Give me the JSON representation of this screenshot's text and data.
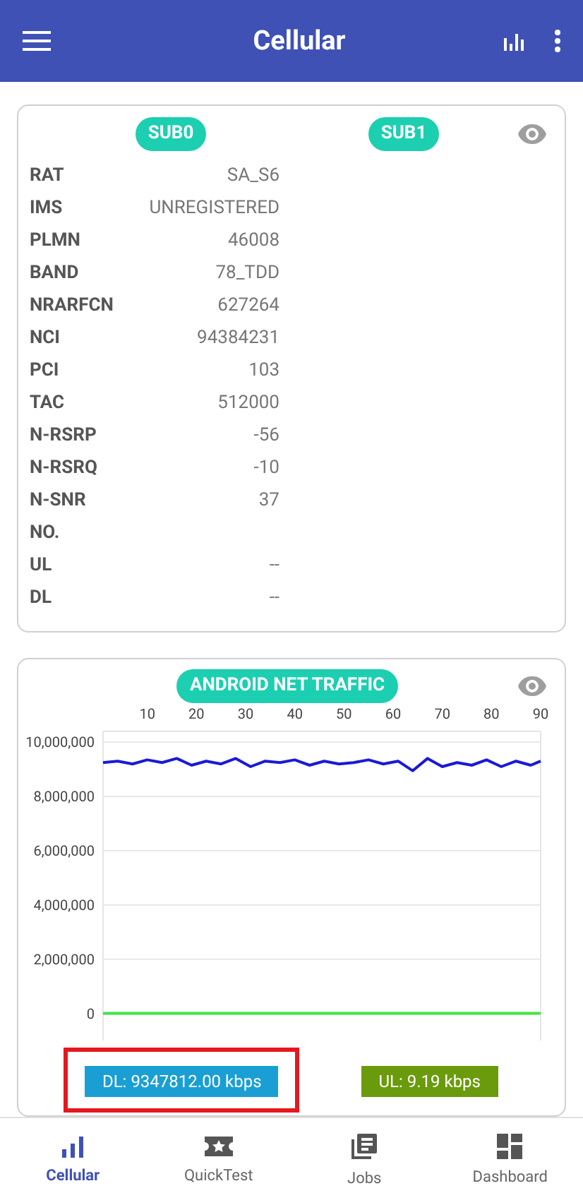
{
  "app_bar": {
    "title": "Cellular"
  },
  "sim_card": {
    "tabs": [
      {
        "label": "SUB0"
      },
      {
        "label": "SUB1"
      }
    ],
    "rows": [
      {
        "label": "RAT",
        "value": "SA_S6"
      },
      {
        "label": "IMS",
        "value": "UNREGISTERED"
      },
      {
        "label": "PLMN",
        "value": "46008"
      },
      {
        "label": "BAND",
        "value": "78_TDD"
      },
      {
        "label": "NRARFCN",
        "value": "627264"
      },
      {
        "label": "NCI",
        "value": "94384231"
      },
      {
        "label": "PCI",
        "value": "103"
      },
      {
        "label": "TAC",
        "value": "512000"
      },
      {
        "label": "N-RSRP",
        "value": "-56"
      },
      {
        "label": "N-RSRQ",
        "value": "-10"
      },
      {
        "label": "N-SNR",
        "value": "37"
      },
      {
        "label": "NO."
      },
      {
        "label": "UL",
        "value": "--"
      },
      {
        "label": "DL",
        "value": "--"
      }
    ]
  },
  "traffic_card": {
    "title": "ANDROID NET TRAFFIC",
    "chart_data": {
      "type": "line",
      "grid": true,
      "xlim": [
        1,
        90
      ],
      "ylim": [
        -1000000,
        10400000
      ],
      "xticks": [
        10,
        20,
        30,
        40,
        50,
        60,
        70,
        80,
        90
      ],
      "yticks": [
        {
          "value": 0,
          "label": "0"
        },
        {
          "value": 2000000,
          "label": "2,000,000"
        },
        {
          "value": 4000000,
          "label": "4,000,000"
        },
        {
          "value": 6000000,
          "label": "6,000,000"
        },
        {
          "value": 8000000,
          "label": "8,000,000"
        },
        {
          "value": 10000000,
          "label": "10,000,000"
        }
      ],
      "x": [
        1,
        4,
        7,
        10,
        13,
        16,
        19,
        22,
        25,
        28,
        31,
        34,
        37,
        40,
        43,
        46,
        49,
        52,
        55,
        58,
        61,
        64,
        67,
        70,
        73,
        76,
        79,
        82,
        85,
        88,
        90
      ],
      "series": [
        {
          "color": "#1a1ad6",
          "values": [
            9250000,
            9300000,
            9200000,
            9350000,
            9250000,
            9400000,
            9150000,
            9300000,
            9200000,
            9400000,
            9100000,
            9300000,
            9250000,
            9350000,
            9150000,
            9300000,
            9200000,
            9250000,
            9350000,
            9200000,
            9300000,
            8950000,
            9400000,
            9100000,
            9250000,
            9150000,
            9350000,
            9100000,
            9300000,
            9150000,
            9300000
          ]
        },
        {
          "color": "#3ee83e",
          "values": [
            0,
            0,
            0,
            0,
            0,
            0,
            0,
            0,
            0,
            0,
            0,
            0,
            0,
            0,
            0,
            0,
            0,
            0,
            0,
            0,
            0,
            0,
            0,
            0,
            0,
            0,
            0,
            0,
            0,
            0,
            0
          ]
        }
      ]
    },
    "badges": [
      {
        "text": "DL: 9347812.00 kbps",
        "color": "#1a9fd4",
        "highlighted": true
      },
      {
        "text": "UL: 9.19 kbps",
        "color": "#6a9b0c",
        "highlighted": false
      }
    ]
  },
  "bottom_nav": [
    {
      "kind": "cellular",
      "label": "Cellular",
      "selected": true
    },
    {
      "kind": "quicktest",
      "label": "QuickTest",
      "selected": false
    },
    {
      "kind": "jobs",
      "label": "Jobs",
      "selected": false
    },
    {
      "kind": "dashboard",
      "label": "Dashboard",
      "selected": false
    }
  ]
}
